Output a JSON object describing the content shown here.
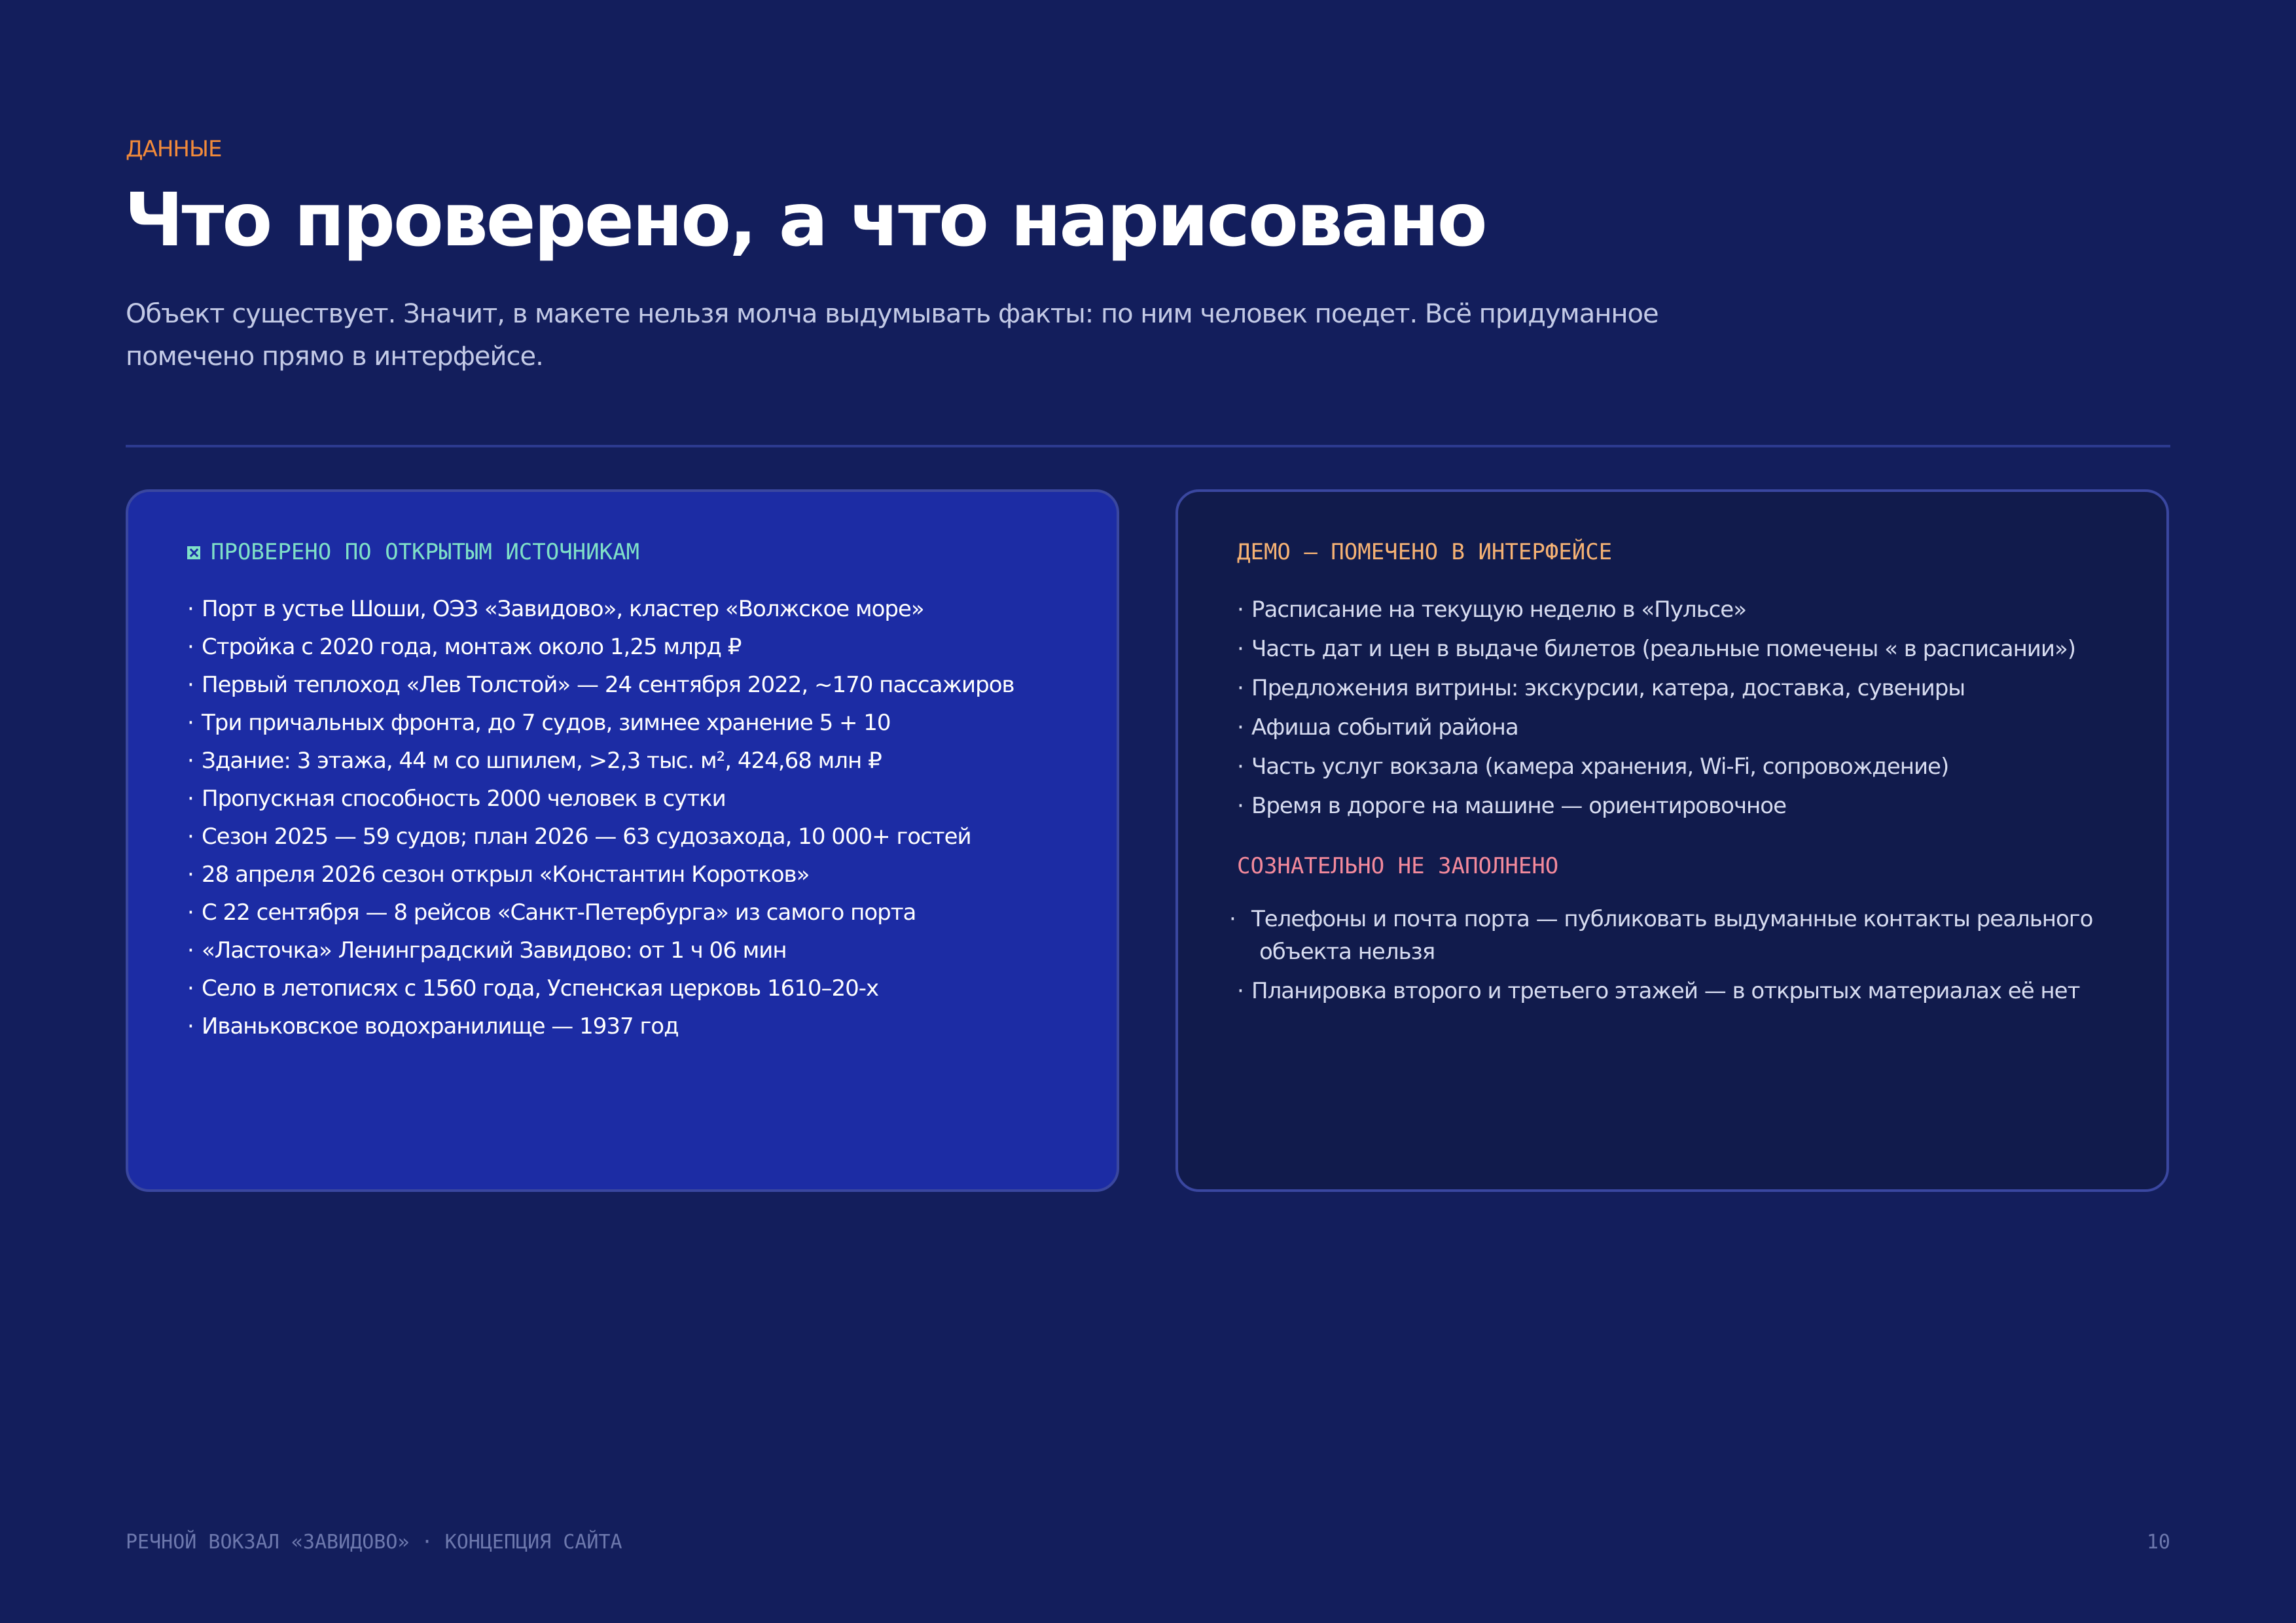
{
  "kicker": "ДАННЫЕ",
  "title": "Что проверено, а что нарисовано",
  "subtitle": "Объект существует. Значит, в макете нельзя молча выдумывать факты: по ним человек поедет. Всё придуманное помечено прямо в интерфейсе.",
  "verified": {
    "heading": "ПРОВЕРЕНО ПО ОТКРЫТЫМ ИСТОЧНИКАМ",
    "icon": "check-box-icon",
    "items": [
      "Порт в устье Шоши, ОЭЗ «Завидово», кластер «Волжское море»",
      "Стройка с 2020 года, монтаж около 1,25 млрд ₽",
      "Первый теплоход «Лев Толстой» — 24 сентября 2022, ~170 пассажиров",
      "Три причальных фронта, до 7 судов, зимнее хранение 5 + 10",
      "Здание: 3 этажа, 44 м со шпилем, >2,3 тыс. м², 424,68 млн ₽",
      "Пропускная способность 2000 человек в сутки",
      "Сезон 2025 — 59 судов; план 2026 — 63 судозахода, 10 000+ гостей",
      "28 апреля 2026 сезон открыл «Константин Коротков»",
      "С 22 сентября — 8 рейсов «Санкт-Петербурга» из самого порта",
      "«Ласточка» Ленинградский  Завидово: от 1 ч 06 мин",
      "Село в летописях с 1560 года, Успенская церковь 1610–20-х",
      "Иваньковское водохранилище — 1937 год"
    ]
  },
  "demo": {
    "heading": "ДЕМО — ПОМЕЧЕНО В ИНТЕРФЕЙСЕ",
    "items": [
      "Расписание на текущую неделю в «Пульсе»",
      "Часть дат и цен в выдаче билетов (реальные помечены « в расписании»)",
      "Предложения витрины: экскурсии, катера, доставка, сувениры",
      "Афиша событий района",
      "Часть услуг вокзала (камера хранения, Wi-Fi, сопровождение)",
      "Время в дороге на машине — ориентировочное"
    ]
  },
  "not_filled": {
    "heading": "СОЗНАТЕЛЬНО НЕ ЗАПОЛНЕНО",
    "items": [
      "Телефоны и почта порта — публиковать выдуманные контакты реального объекта нельзя",
      "Планировка второго и третьего этажей — в открытых материалах её нет"
    ]
  },
  "footer": {
    "left": "РЕЧНОЙ ВОКЗАЛ «ЗАВИДОВО» · КОНЦЕПЦИЯ САЙТА",
    "page_number": "10"
  },
  "colors": {
    "background": "#131e5c",
    "accent_orange": "#f28a3a",
    "verified_card": "#1c2ca4",
    "verified_heading": "#7fe0c8",
    "demo_heading": "#f6b274",
    "not_filled_heading": "#f48a9c"
  }
}
